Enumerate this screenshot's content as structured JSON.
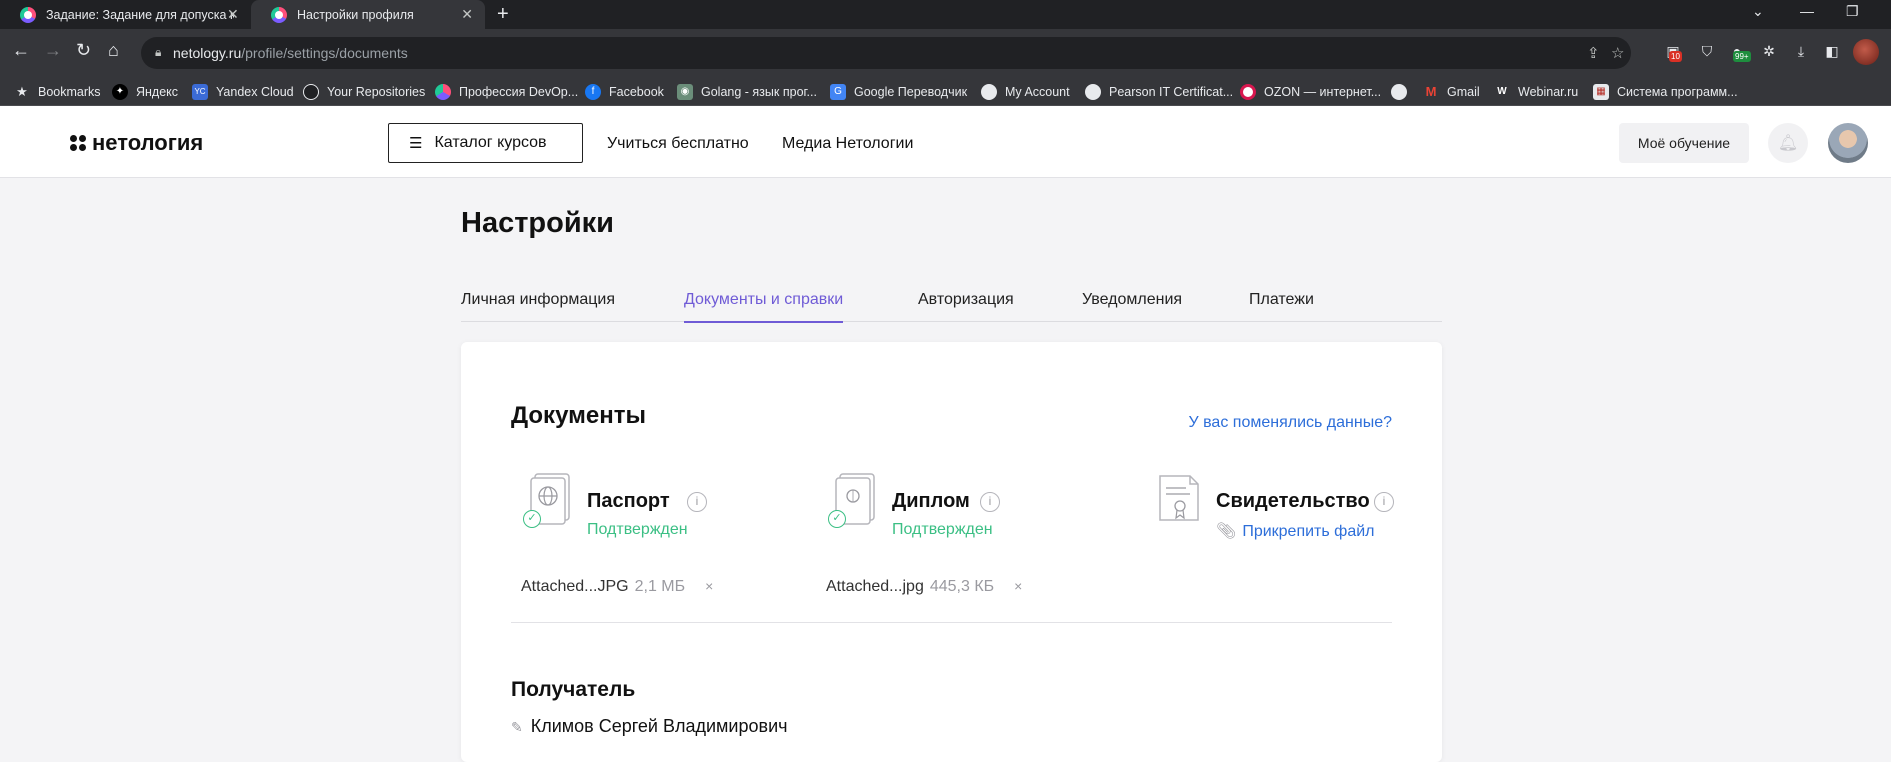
{
  "browser": {
    "tabs": [
      {
        "title": "Задание: Задание для допуска к",
        "active": false
      },
      {
        "title": "Настройки профиля",
        "active": true
      }
    ],
    "url_domain": "netology.ru",
    "url_path": "/profile/settings/documents",
    "extension_badges": [
      "10",
      "99+"
    ],
    "bookmarks": [
      {
        "label": "Bookmarks",
        "icon": "star-icon"
      },
      {
        "label": "Яндекс",
        "icon": "yandex-icon"
      },
      {
        "label": "Yandex Cloud",
        "icon": "yandex-cloud-icon",
        "icon_text": "YC"
      },
      {
        "label": "Your Repositories",
        "icon": "github-icon"
      },
      {
        "label": "Профессия DevOp...",
        "icon": "netology-icon"
      },
      {
        "label": "Facebook",
        "icon": "facebook-icon"
      },
      {
        "label": "Golang - язык прог...",
        "icon": "golang-icon"
      },
      {
        "label": "Google Переводчик",
        "icon": "google-translate-icon"
      },
      {
        "label": "My Account",
        "icon": "globe-icon"
      },
      {
        "label": "Pearson IT Certificat...",
        "icon": "globe-icon"
      },
      {
        "label": "OZON — интернет...",
        "icon": "ozon-icon"
      },
      {
        "label": "",
        "icon": "globe-icon"
      },
      {
        "label": "Gmail",
        "icon": "gmail-icon"
      },
      {
        "label": "Webinar.ru",
        "icon": "webinar-icon",
        "icon_text": "W"
      },
      {
        "label": "Система программ...",
        "icon": "app-icon"
      }
    ]
  },
  "header": {
    "logo": "нетология",
    "catalog_button": "Каталог курсов",
    "nav": [
      "Учиться бесплатно",
      "Медиа Нетологии"
    ],
    "my_learning": "Моё обучение"
  },
  "page": {
    "title": "Настройки",
    "tabs": [
      {
        "label": "Личная информация",
        "active": false
      },
      {
        "label": "Документы и справки",
        "active": true
      },
      {
        "label": "Авторизация",
        "active": false
      },
      {
        "label": "Уведомления",
        "active": false
      },
      {
        "label": "Платежи",
        "active": false
      }
    ]
  },
  "documents": {
    "heading": "Документы",
    "changed_link": "У вас поменялись данные?",
    "items": [
      {
        "name": "Паспорт",
        "status": "Подтвержден",
        "file_name": "Attached...JPG",
        "file_size": "2,1 МБ",
        "remove": "×"
      },
      {
        "name": "Диплом",
        "status": "Подтвержден",
        "file_name": "Attached...jpg",
        "file_size": "445,3 КБ",
        "remove": "×"
      },
      {
        "name": "Свидетельство",
        "attach_label": "Прикрепить файл"
      }
    ]
  },
  "recipient": {
    "heading": "Получатель",
    "name": "Климов Сергей Владимирович"
  },
  "colors": {
    "accent": "#6f5bd6",
    "link": "#2d6ed9",
    "success": "#3bbf84"
  }
}
